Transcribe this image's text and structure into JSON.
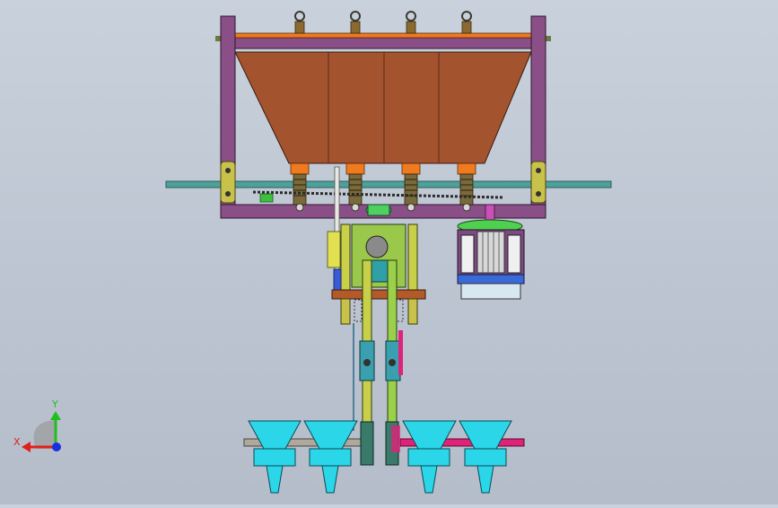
{
  "viewport": {
    "background_top": "#c9d1dc",
    "background_bottom": "#b4bdc9"
  },
  "triad": {
    "x_label": "X",
    "y_label": "Y",
    "x_color": "#e0201a",
    "y_color": "#1fbf1f",
    "z_color": "#1a2fe0"
  },
  "model": {
    "frame_color": "#8a4f86",
    "hopper_color": "#a4532f",
    "outlet_color": "#f07a1e",
    "shaft_color": "#4fa09a",
    "motor_color": "#7d4a82",
    "cup_color": "#2ad6e8",
    "guide_color": "#c8c24a",
    "bar_color": "#b35a2a",
    "accent_pink": "#e0237a"
  }
}
